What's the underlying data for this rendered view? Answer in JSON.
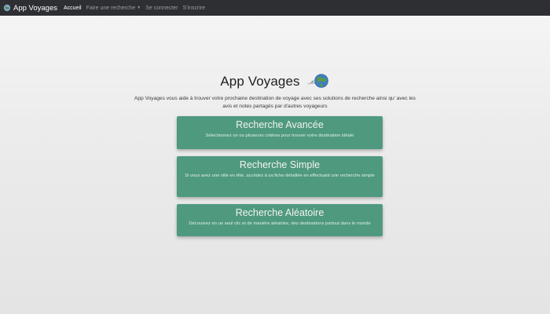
{
  "navbar": {
    "brand": "App Voyages",
    "links": [
      {
        "label": "Accueil"
      },
      {
        "label": "Faire une recherche"
      },
      {
        "label": "Se connecter"
      },
      {
        "label": "S'inscrire"
      }
    ]
  },
  "hero": {
    "title": "App Voyages",
    "description": "App Voyages vous aide à trouver votre prochaine destination de voyage avec ses solutions de recherche ainsi qu' avec les avis et notes partagés par d'autres voyageurs"
  },
  "cards": [
    {
      "title": "Recherche Avancée",
      "description": "Sélectionnez un ou plusieurs critères pour trouver votre destination idéale"
    },
    {
      "title": "Recherche Simple",
      "description": "Si vous avez une ville en tête, accédez à sa fiche détaillée en effectuant une recherche simple"
    },
    {
      "title": "Recherche Aléatoire",
      "description": "Découvrez en un seul clic et de manière aléatoire, des destinations partout dans le monde"
    }
  ],
  "colors": {
    "navbar_bg": "#2e2f33",
    "card_bg": "#4f9a7f",
    "nav_active": "#ffffff",
    "nav_inactive": "#9b9da3"
  },
  "icons": {
    "brand": "globe-icon",
    "hero": "globe-airplane-icon",
    "dropdown": "caret-down-icon"
  }
}
